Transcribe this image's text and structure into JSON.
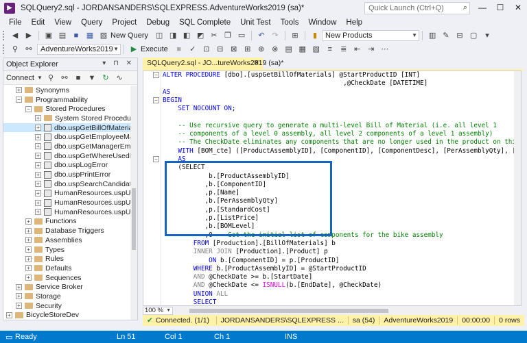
{
  "window": {
    "title": "SQLQuery2.sql - JORDANSANDERS\\SQLEXPRESS.AdventureWorks2019 (sa)*",
    "quick_launch_placeholder": "Quick Launch (Ctrl+Q)",
    "search_glyph": "⌕",
    "minimize": "—",
    "maximize": "☐",
    "close": "✕"
  },
  "menu": [
    "File",
    "Edit",
    "View",
    "Query",
    "Project",
    "Debug",
    "SQL Complete",
    "Unit Test",
    "Tools",
    "Window",
    "Help"
  ],
  "toolbar1": {
    "new_query_label": "New Query",
    "solution_combo": "New Products"
  },
  "toolbar2": {
    "database_combo": "AdventureWorks2019",
    "execute_label": "Execute"
  },
  "object_explorer": {
    "title": "Object Explorer",
    "header_buttons": "▾ ⊓ ✕",
    "connect_label": "Connect",
    "tree": [
      {
        "label": "Synonyms",
        "depth": 1,
        "kind": "folder",
        "expander": "+"
      },
      {
        "label": "Programmability",
        "depth": 1,
        "kind": "folder",
        "expander": "−"
      },
      {
        "label": "Stored Procedures",
        "depth": 2,
        "kind": "folder",
        "expander": "−"
      },
      {
        "label": "System Stored Procedures",
        "depth": 3,
        "kind": "folder",
        "expander": "+"
      },
      {
        "label": "dbo.uspGetBillOfMaterials",
        "depth": 3,
        "kind": "proc",
        "expander": "+",
        "selected": true
      },
      {
        "label": "dbo.uspGetEmployeeManage",
        "depth": 3,
        "kind": "proc",
        "expander": "+"
      },
      {
        "label": "dbo.uspGetManagerEmploye",
        "depth": 3,
        "kind": "proc",
        "expander": "+"
      },
      {
        "label": "dbo.uspGetWhereUsedProdu",
        "depth": 3,
        "kind": "proc",
        "expander": "+"
      },
      {
        "label": "dbo.uspLogError",
        "depth": 3,
        "kind": "proc",
        "expander": "+"
      },
      {
        "label": "dbo.uspPrintError",
        "depth": 3,
        "kind": "proc",
        "expander": "+"
      },
      {
        "label": "dbo.uspSearchCandidateResu",
        "depth": 3,
        "kind": "proc",
        "expander": "+"
      },
      {
        "label": "HumanResources.uspUpdateE",
        "depth": 3,
        "kind": "proc",
        "expander": "+"
      },
      {
        "label": "HumanResources.uspUpdateE",
        "depth": 3,
        "kind": "proc",
        "expander": "+"
      },
      {
        "label": "HumanResources.uspUpdateE",
        "depth": 3,
        "kind": "proc",
        "expander": "+"
      },
      {
        "label": "Functions",
        "depth": 2,
        "kind": "folder",
        "expander": "+"
      },
      {
        "label": "Database Triggers",
        "depth": 2,
        "kind": "folder",
        "expander": "+"
      },
      {
        "label": "Assemblies",
        "depth": 2,
        "kind": "folder",
        "expander": "+"
      },
      {
        "label": "Types",
        "depth": 2,
        "kind": "folder",
        "expander": "+"
      },
      {
        "label": "Rules",
        "depth": 2,
        "kind": "folder",
        "expander": "+"
      },
      {
        "label": "Defaults",
        "depth": 2,
        "kind": "folder",
        "expander": "+"
      },
      {
        "label": "Sequences",
        "depth": 2,
        "kind": "folder",
        "expander": "+"
      },
      {
        "label": "Service Broker",
        "depth": 1,
        "kind": "folder",
        "expander": "+"
      },
      {
        "label": "Storage",
        "depth": 1,
        "kind": "folder",
        "expander": "+"
      },
      {
        "label": "Security",
        "depth": 1,
        "kind": "folder",
        "expander": "+"
      },
      {
        "label": "BicycleStoreDev",
        "depth": 0,
        "kind": "folder",
        "expander": "+"
      }
    ]
  },
  "editor": {
    "tab_label": "SQLQuery2.sql - JO...tureWorks2019 (sa)*",
    "tab_close": "✕",
    "lines": [
      [
        [
          "kw",
          "ALTER PROCEDURE "
        ],
        [
          "tx",
          "[dbo].[uspGetBillOfMaterials] @StartProductID "
        ],
        [
          "tx",
          "[INT]"
        ]
      ],
      [
        [
          "tx",
          "                                               ,@CheckDate [DATETIME]"
        ]
      ],
      [
        [
          "kw",
          "AS"
        ]
      ],
      [
        [
          "kw",
          "BEGIN"
        ]
      ],
      [
        [
          "kw",
          "    SET NOCOUNT ON"
        ],
        [
          "tx",
          ";"
        ]
      ],
      [
        [
          "tx",
          ""
        ]
      ],
      [
        [
          "cm",
          "    -- Use recursive query to generate a multi-level Bill of Material (i.e. all level 1"
        ]
      ],
      [
        [
          "cm",
          "    -- components of a level 0 assembly, all level 2 components of a level 1 assembly)"
        ]
      ],
      [
        [
          "cm",
          "    -- The CheckDate eliminates any components that are no longer used in the product on this d"
        ]
      ],
      [
        [
          "kw",
          "    WITH "
        ],
        [
          "tx",
          "[BOM_cte] ([ProductAssemblyID], [ComponentID], [ComponentDesc], [PerAssemblyQty], [Sta"
        ]
      ],
      [
        [
          "kw",
          "    AS"
        ]
      ],
      [
        [
          "tx",
          "    (SELECT"
        ]
      ],
      [
        [
          "tx",
          "            b.[ProductAssemblyID]"
        ]
      ],
      [
        [
          "tx",
          "           ,b.[ComponentID]"
        ]
      ],
      [
        [
          "tx",
          "           ,p.[Name]"
        ]
      ],
      [
        [
          "tx",
          "           ,b.[PerAssemblyQty]"
        ]
      ],
      [
        [
          "tx",
          "           ,p.[StandardCost]"
        ]
      ],
      [
        [
          "tx",
          "           ,p.[ListPrice]"
        ]
      ],
      [
        [
          "tx",
          "           ,b.[BOMLevel]"
        ]
      ],
      [
        [
          "tx",
          "           ,0 "
        ],
        [
          "cm",
          "-- Get the initial list of components for the bike assembly"
        ]
      ],
      [
        [
          "kw",
          "        FROM "
        ],
        [
          "tx",
          "[Production].[BillOfMaterials] b"
        ]
      ],
      [
        [
          "gr",
          "        INNER JOIN "
        ],
        [
          "tx",
          "[Production].[Product] p"
        ]
      ],
      [
        [
          "kw",
          "            ON "
        ],
        [
          "tx",
          "b.[ComponentID] = p.[ProductID]"
        ]
      ],
      [
        [
          "kw",
          "        WHERE "
        ],
        [
          "tx",
          "b.[ProductAssemblyID] = @StartProductID"
        ]
      ],
      [
        [
          "gr",
          "        AND "
        ],
        [
          "tx",
          "@CheckDate >= b.[StartDate]"
        ]
      ],
      [
        [
          "gr",
          "        AND "
        ],
        [
          "tx",
          "@CheckDate <= "
        ],
        [
          "fn",
          "ISNULL"
        ],
        [
          "tx",
          "(b.[EndDate], @CheckDate)"
        ]
      ],
      [
        [
          "kw",
          "        UNION "
        ],
        [
          "gr",
          "ALL"
        ]
      ],
      [
        [
          "kw",
          "        SELECT"
        ]
      ]
    ]
  },
  "zoom_level": "100 %",
  "connection_bar": {
    "status": "Connected. (1/1)",
    "server": "JORDANSANDERS\\SQLEXPRESS ...",
    "user": "sa (54)",
    "database": "AdventureWorks2019",
    "elapsed": "00:00:00",
    "rows": "0 rows"
  },
  "status_bar": {
    "ready": "Ready",
    "ln": "Ln 51",
    "col": "Col 1",
    "ch": "Ch 1",
    "ins": "INS"
  },
  "colors": {
    "keyword": "#0000ff",
    "comment": "#008000",
    "gray_keyword": "#808080",
    "function": "#ff00ff",
    "text": "#000000",
    "accent": "#007acc",
    "highlight": "#1565c0"
  }
}
